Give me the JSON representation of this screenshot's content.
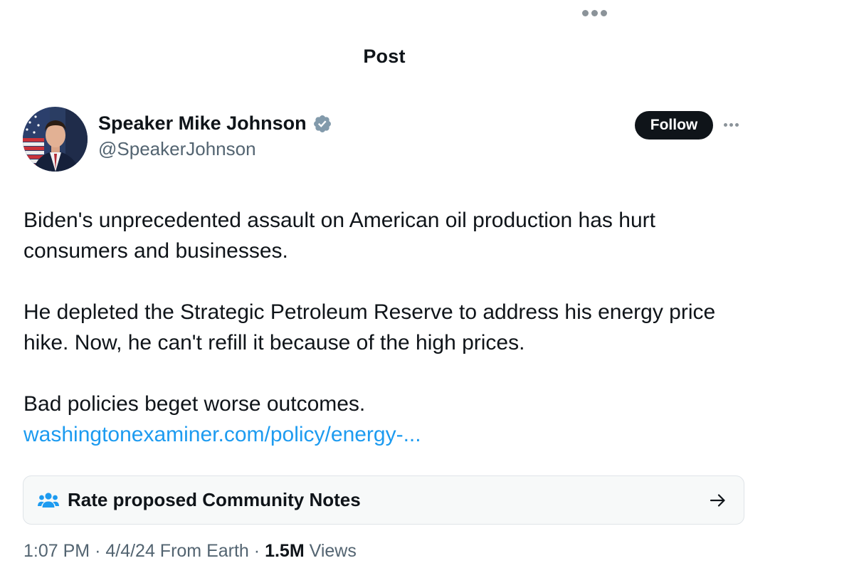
{
  "header": {
    "title": "Post"
  },
  "post": {
    "author": {
      "display_name": "Speaker Mike Johnson",
      "handle": "@SpeakerJohnson",
      "verified_icon": "verified-badge-icon"
    },
    "follow_label": "Follow",
    "body": {
      "paragraph_1": "Biden's unprecedented assault on American oil production has hurt consumers and businesses.",
      "paragraph_2": "He depleted the Strategic Petroleum Reserve to address his energy price hike. Now, he can't refill it because of the high prices.",
      "paragraph_3": "Bad policies beget worse outcomes.",
      "link": "washingtonexaminer.com/policy/energy-..."
    },
    "community_notes": {
      "label": "Rate proposed Community Notes",
      "icon": "people-icon",
      "arrow_icon": "arrow-right-icon"
    },
    "meta": {
      "time": "1:07 PM",
      "separator": "·",
      "date_location": "4/4/24 From Earth",
      "views_count": "1.5M",
      "views_label": "Views"
    }
  },
  "colors": {
    "text_primary": "#0f1419",
    "text_secondary": "#536471",
    "link": "#1d9bf0",
    "follow_bg": "#0f1419",
    "verified": "#829aab",
    "notes_icon": "#1d9bf0"
  }
}
